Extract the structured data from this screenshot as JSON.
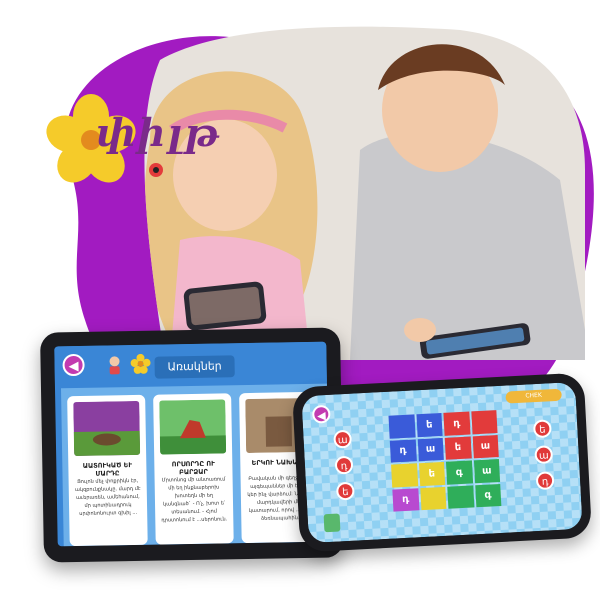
{
  "logo": {
    "text": "փիլթ"
  },
  "tablet": {
    "title": "Առակներ",
    "cards": [
      {
        "title": "ԱԱՏՈՒԿԱԾ ԵՒ ՄԱՐԴԸ",
        "text": "Ցուլոն մեչ փոքրիկն էր, ակզբունքնակը. մարդ մէ աւերառեն, ամեհանում, մր պոտինադրուկ սրփոնոնուրտ զխիլ ..."
      },
      {
        "title": "ՈՐՍՈՐԴԸ ՈՒ ԲԱՐՁԱՐ",
        "text": "Մրտոնոց մի անտառում մի եղ ինքնաբերոխ խոտեղն մի եղ կանգնած` - Ո՛չ, խոտ ե՛ տեսանում. - Հյոմ դրստոնում է ...սերոնուն."
      },
      {
        "title": "ԵՐԿՈՒ ՆԱԽԱՆՁ",
        "text": "Բավական մի գեղջկան, այգեպաններ մի եղ մի կեր ինչ վարձում: Նրանք մարդկավերի մեջ կատարում, որով ... մեկ ձեռնապահին."
      }
    ]
  },
  "phone": {
    "progress_label": "CHEK",
    "left_letters": [
      "ա",
      "դ",
      "ե"
    ],
    "right_letters": [
      "ե",
      "ա",
      "դ"
    ],
    "grid": [
      {
        "letter": "",
        "color": "#3a5bd9"
      },
      {
        "letter": "ե",
        "color": "#3a5bd9"
      },
      {
        "letter": "դ",
        "color": "#e23b3b"
      },
      {
        "letter": "",
        "color": "#e23b3b"
      },
      {
        "letter": "դ",
        "color": "#3a5bd9"
      },
      {
        "letter": "ա",
        "color": "#3a5bd9"
      },
      {
        "letter": "ե",
        "color": "#e23b3b"
      },
      {
        "letter": "ա",
        "color": "#e23b3b"
      },
      {
        "letter": "",
        "color": "#e8d22e"
      },
      {
        "letter": "ե",
        "color": "#e8d22e"
      },
      {
        "letter": "գ",
        "color": "#2fae5a"
      },
      {
        "letter": "ա",
        "color": "#2fae5a"
      },
      {
        "letter": "դ",
        "color": "#b84ad0"
      },
      {
        "letter": "",
        "color": "#e8d22e"
      },
      {
        "letter": "",
        "color": "#2fae5a"
      },
      {
        "letter": "գ",
        "color": "#2fae5a"
      }
    ]
  },
  "colors": {
    "blob": "#a21bc1",
    "accent": "#c33bb0",
    "tablet_bg": "#3a86d6"
  }
}
